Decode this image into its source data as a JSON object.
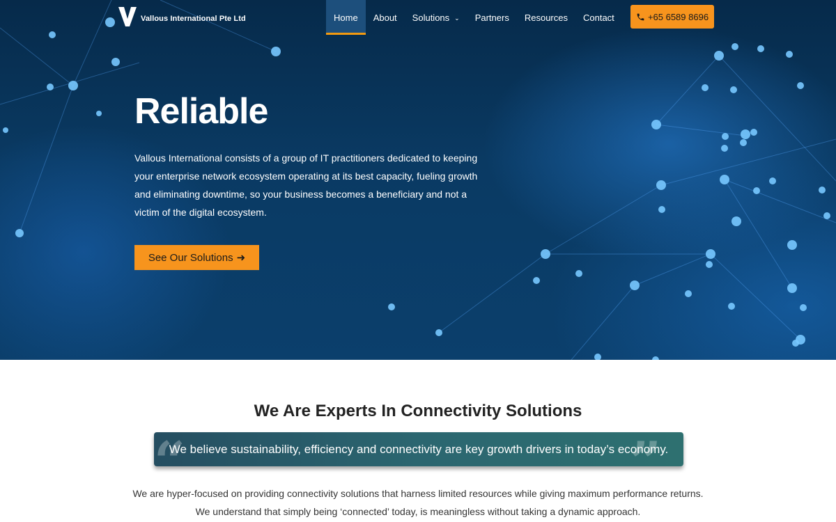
{
  "header": {
    "logo_text": "Vallous International Pte Ltd",
    "nav": [
      {
        "label": "Home",
        "active": true
      },
      {
        "label": "About"
      },
      {
        "label": "Solutions",
        "has_dropdown": true
      },
      {
        "label": "Partners"
      },
      {
        "label": "Resources"
      },
      {
        "label": "Contact"
      }
    ],
    "phone_label": "+65 6589 8696"
  },
  "hero": {
    "title": "Reliable",
    "body": "Vallous International consists of a group of IT practitioners dedicated to keeping your enterprise network ecosystem operating at its best capacity, fueling growth and eliminating downtime, so your business becomes a beneficiary and not a victim of the digital ecosystem.",
    "cta_label": "See Our Solutions",
    "cta_icon": "arrow-right-icon"
  },
  "intro": {
    "title": "We Are Experts In Connectivity Solutions",
    "quote": "We believe sustainability, efficiency and connectivity are key growth drivers in today’s economy.",
    "paragraph_lines": [
      "We are hyper-focused on providing connectivity solutions that harness limited resources while giving maximum performance returns.",
      "We understand that simply being ‘connected’ today, is meaningless without taking a dynamic approach."
    ]
  },
  "colors": {
    "accent": "#f7941d",
    "hero_dark": "#0a3a63",
    "quote_bg": "#2b6670"
  }
}
